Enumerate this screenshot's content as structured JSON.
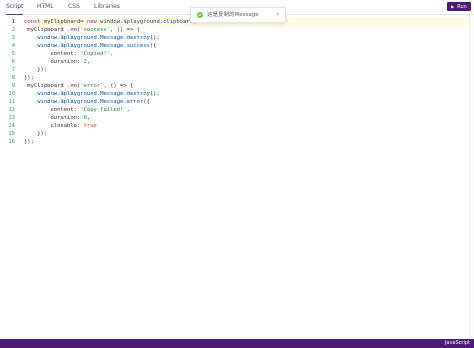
{
  "tabs": [
    {
      "label": "Script",
      "active": true
    },
    {
      "label": "HTML",
      "active": false
    },
    {
      "label": "CSS",
      "active": false
    },
    {
      "label": "Libraries",
      "active": false
    }
  ],
  "run_button": {
    "label": "Run",
    "icon": "play-icon"
  },
  "toast": {
    "type": "success",
    "icon": "check-circle-icon",
    "text": "这是复制的Message",
    "close": "×"
  },
  "editor": {
    "line_numbers": [
      "1",
      "2",
      "3",
      "4",
      "5",
      "6",
      "7",
      "8",
      "9",
      "10",
      "11",
      "12",
      "13",
      "14",
      "15",
      "16"
    ],
    "active_line": 1,
    "lines": [
      "const myClipboard= new window.$playground.clipboard('.",
      " myClipboard .on('success', () => {",
      "    window.$playground.Message.destroy();",
      "    window.$playground.Message.success({",
      "        content: 'Copied!',",
      "        duration: 2,",
      "    });",
      "});",
      " myClipboard .on('error', () => {",
      "    window.$playground.Message.destroy();",
      "    window.$playground.Message.error({",
      "        content: 'Copy failed!',",
      "        duration: 0,",
      "        closable: true",
      "    });",
      "});"
    ]
  },
  "status_bar": {
    "language": "JavaScript"
  },
  "colors": {
    "accent": "#4b1d78",
    "active_tab": "#6b2c91",
    "success": "#67c23a"
  }
}
